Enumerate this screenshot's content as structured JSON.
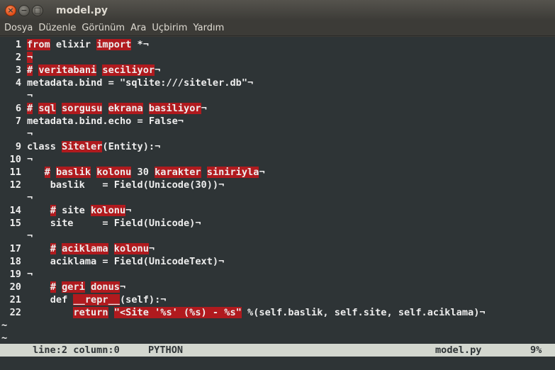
{
  "window": {
    "title": "model.py",
    "close_glyph": "×",
    "min_glyph": "−",
    "max_glyph": "□"
  },
  "menu": [
    "Dosya",
    "Düzenle",
    "Görünüm",
    "Ara",
    "Uçbirim",
    "Yardım"
  ],
  "editor": {
    "lines": [
      {
        "n": "1",
        "segs": [
          {
            "t": "from",
            "hl": true
          },
          {
            "t": " elixir "
          },
          {
            "t": "import",
            "hl": true
          },
          {
            "t": " *"
          },
          {
            "t": "¬"
          }
        ]
      },
      {
        "n": "2",
        "segs": [
          {
            "t": "¬",
            "hl": true
          }
        ]
      },
      {
        "n": "3",
        "segs": [
          {
            "t": "#",
            "hl": true
          },
          {
            "t": " "
          },
          {
            "t": "veritabani",
            "hl": true
          },
          {
            "t": " "
          },
          {
            "t": "seciliyor",
            "hl": true
          },
          {
            "t": "¬"
          }
        ]
      },
      {
        "n": "4",
        "segs": [
          {
            "t": "metadata.bind = \"sqlite:///siteler.db\""
          },
          {
            "t": "¬"
          }
        ]
      },
      {
        "n": "",
        "segs": [
          {
            "t": "¬"
          }
        ]
      },
      {
        "n": "6",
        "segs": [
          {
            "t": "#",
            "hl": true
          },
          {
            "t": " "
          },
          {
            "t": "sql",
            "hl": true
          },
          {
            "t": " "
          },
          {
            "t": "sorgusu",
            "hl": true
          },
          {
            "t": " "
          },
          {
            "t": "ekrana",
            "hl": true
          },
          {
            "t": " "
          },
          {
            "t": "basiliyor",
            "hl": true
          },
          {
            "t": "¬"
          }
        ]
      },
      {
        "n": "7",
        "segs": [
          {
            "t": "metadata.bind.echo = False"
          },
          {
            "t": "¬"
          }
        ]
      },
      {
        "n": "",
        "segs": [
          {
            "t": "¬"
          }
        ]
      },
      {
        "n": "9",
        "segs": [
          {
            "t": "class "
          },
          {
            "t": "Siteler",
            "hl": true
          },
          {
            "t": "(Entity):"
          },
          {
            "t": "¬"
          }
        ]
      },
      {
        "n": "10",
        "segs": [
          {
            "t": "¬"
          }
        ]
      },
      {
        "n": "11",
        "segs": [
          {
            "t": "   "
          },
          {
            "t": "#",
            "hl": true
          },
          {
            "t": " "
          },
          {
            "t": "baslik",
            "hl": true
          },
          {
            "t": " "
          },
          {
            "t": "kolonu",
            "hl": true
          },
          {
            "t": " 30 "
          },
          {
            "t": "karakter",
            "hl": true
          },
          {
            "t": " "
          },
          {
            "t": "siniriyla",
            "hl": true
          },
          {
            "t": "¬"
          }
        ]
      },
      {
        "n": "12",
        "segs": [
          {
            "t": "    baslik   = Field(Unicode(30))"
          },
          {
            "t": "¬"
          }
        ]
      },
      {
        "n": "",
        "segs": [
          {
            "t": "¬"
          }
        ]
      },
      {
        "n": "14",
        "segs": [
          {
            "t": "    "
          },
          {
            "t": "#",
            "hl": true
          },
          {
            "t": " site "
          },
          {
            "t": "kolonu",
            "hl": true
          },
          {
            "t": "¬"
          }
        ]
      },
      {
        "n": "15",
        "segs": [
          {
            "t": "    site     = Field(Unicode)"
          },
          {
            "t": "¬"
          }
        ]
      },
      {
        "n": "",
        "segs": [
          {
            "t": "¬"
          }
        ]
      },
      {
        "n": "17",
        "segs": [
          {
            "t": "    "
          },
          {
            "t": "#",
            "hl": true
          },
          {
            "t": " "
          },
          {
            "t": "aciklama",
            "hl": true
          },
          {
            "t": " "
          },
          {
            "t": "kolonu",
            "hl": true
          },
          {
            "t": "¬"
          }
        ]
      },
      {
        "n": "18",
        "segs": [
          {
            "t": "    aciklama = Field(UnicodeText)"
          },
          {
            "t": "¬"
          }
        ]
      },
      {
        "n": "19",
        "segs": [
          {
            "t": "¬"
          }
        ]
      },
      {
        "n": "20",
        "segs": [
          {
            "t": "    "
          },
          {
            "t": "#",
            "hl": true
          },
          {
            "t": " "
          },
          {
            "t": "geri",
            "hl": true
          },
          {
            "t": " "
          },
          {
            "t": "donus",
            "hl": true
          },
          {
            "t": "¬"
          }
        ]
      },
      {
        "n": "21",
        "segs": [
          {
            "t": "    def "
          },
          {
            "t": "__repr__",
            "hl": true
          },
          {
            "t": "(self):"
          },
          {
            "t": "¬"
          }
        ]
      },
      {
        "n": "22",
        "segs": [
          {
            "t": "        "
          },
          {
            "t": "return",
            "hl": true
          },
          {
            "t": " "
          },
          {
            "t": "\"<Site '%s' (%s) - %s\"",
            "hl": true
          },
          {
            "t": " %(self.baslik, self.site, self.aciklama)"
          },
          {
            "t": "¬"
          }
        ]
      }
    ],
    "tildes": [
      "~",
      "~"
    ]
  },
  "status": {
    "position": "line:2 column:0",
    "mode": "PYTHON",
    "filename": "model.py",
    "percent": "9%"
  },
  "colors": {
    "background": "#2e3436",
    "highlight": "#b01a1e",
    "status_bg": "#d3d7cf"
  }
}
